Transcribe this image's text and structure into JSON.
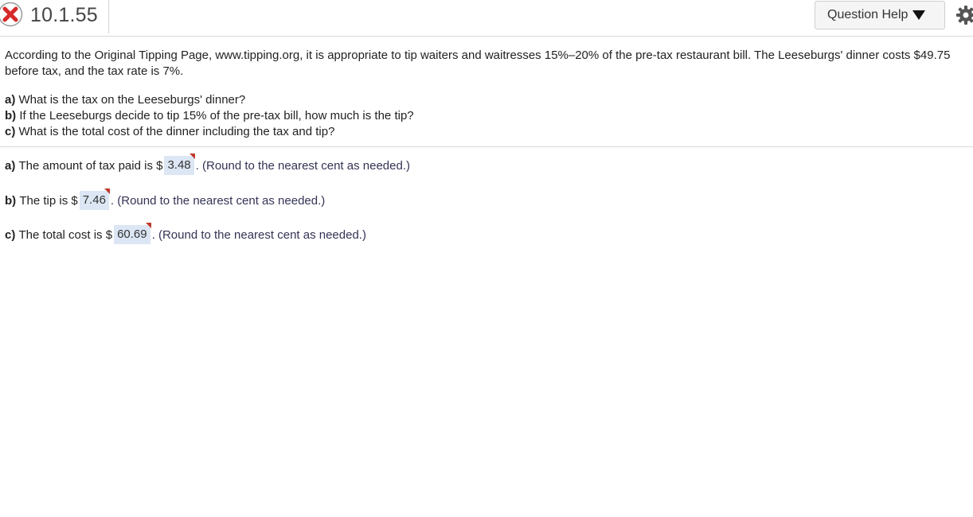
{
  "header": {
    "question_id": "10.1.55",
    "status_icon": "x-circle-icon",
    "status_color": "#d62a2a",
    "help_label": "Question Help",
    "help_caret_icon": "triangle-down-icon",
    "settings_icon": "gear-icon"
  },
  "question": {
    "intro": "According to the Original Tipping Page, www.tipping.org, it is appropriate to tip waiters and waitresses 15%–20% of the pre-tax restaurant bill. The Leeseburgs' dinner costs $49.75 before tax, and the tax rate is 7%.",
    "parts": [
      {
        "label": "a)",
        "text": "What is the tax on the Leeseburgs' dinner?"
      },
      {
        "label": "b)",
        "text": "If the Leeseburgs decide to tip 15% of the pre-tax bill, how much is the tip?"
      },
      {
        "label": "c)",
        "text": "What is the total cost of the dinner including the tax and tip?"
      }
    ]
  },
  "answers": [
    {
      "label": "a)",
      "prefix": "The amount of tax paid is $",
      "value": "3.48",
      "suffix": ". (Round to the nearest cent as needed.)"
    },
    {
      "label": "b)",
      "prefix": "The tip is $",
      "value": "7.46",
      "suffix": ". (Round to the nearest cent as needed.)"
    },
    {
      "label": "c)",
      "prefix": "The total cost is $",
      "value": "60.69",
      "suffix": ". (Round to the nearest cent as needed.)"
    }
  ],
  "colors": {
    "answer_box_bg": "#dce6f4",
    "incorrect_flag": "#c0392b"
  }
}
